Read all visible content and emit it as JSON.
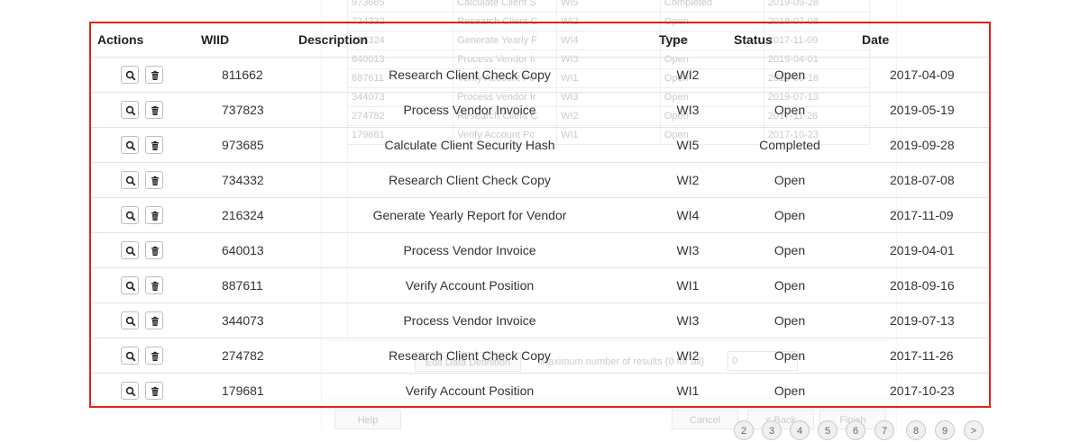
{
  "overlay": {
    "headers": {
      "actions": "Actions",
      "wiid": "WIID",
      "description": "Description",
      "type": "Type",
      "status": "Status",
      "date": "Date"
    },
    "rows": [
      {
        "wiid": "811662",
        "description": "Research Client Check Copy",
        "type": "WI2",
        "status": "Open",
        "date": "2017-04-09"
      },
      {
        "wiid": "737823",
        "description": "Process Vendor Invoice",
        "type": "WI3",
        "status": "Open",
        "date": "2019-05-19"
      },
      {
        "wiid": "973685",
        "description": "Calculate Client Security Hash",
        "type": "WI5",
        "status": "Completed",
        "date": "2019-09-28"
      },
      {
        "wiid": "734332",
        "description": "Research Client Check Copy",
        "type": "WI2",
        "status": "Open",
        "date": "2018-07-08"
      },
      {
        "wiid": "216324",
        "description": "Generate Yearly Report for Vendor",
        "type": "WI4",
        "status": "Open",
        "date": "2017-11-09"
      },
      {
        "wiid": "640013",
        "description": "Process Vendor Invoice",
        "type": "WI3",
        "status": "Open",
        "date": "2019-04-01"
      },
      {
        "wiid": "887611",
        "description": "Verify Account Position",
        "type": "WI1",
        "status": "Open",
        "date": "2018-09-16"
      },
      {
        "wiid": "344073",
        "description": "Process Vendor Invoice",
        "type": "WI3",
        "status": "Open",
        "date": "2019-07-13"
      },
      {
        "wiid": "274782",
        "description": "Research Client Check Copy",
        "type": "WI2",
        "status": "Open",
        "date": "2017-11-26"
      },
      {
        "wiid": "179681",
        "description": "Verify Account Position",
        "type": "WI1",
        "status": "Open",
        "date": "2017-10-23"
      }
    ]
  },
  "background": {
    "rows": [
      [
        "973685",
        "Calculate Client S",
        "WI5",
        "Completed",
        "2019-09-28"
      ],
      [
        "734332",
        "Research Client C",
        "WI2",
        "Open",
        "2018-07-08"
      ],
      [
        "216324",
        "Generate Yearly F",
        "WI4",
        "Open",
        "2017-11-09"
      ],
      [
        "640013",
        "Process Vendor Ir",
        "WI3",
        "Open",
        "2019-04-01"
      ],
      [
        "887611",
        "Verify Account Pc",
        "WI1",
        "Open",
        "2018-09-16"
      ],
      [
        "344073",
        "Process Vendor Ir",
        "WI3",
        "Open",
        "2019-07-13"
      ],
      [
        "274782",
        "Research Client C",
        "WI2",
        "Open",
        "2017-11-26"
      ],
      [
        "179681",
        "Verify Account Pc",
        "WI1",
        "Open",
        "2017-10-23"
      ]
    ],
    "edit_data_definition": "Edit Data Definition",
    "max_results_label": "Maximum number of results (0 for all)",
    "max_results_value": "0",
    "help": "Help",
    "cancel": "Cancel",
    "back": "< Back",
    "finish": "Finish"
  },
  "pagination": [
    "2",
    "3",
    "4",
    "5",
    "6",
    "7",
    "8",
    "9",
    ">"
  ]
}
